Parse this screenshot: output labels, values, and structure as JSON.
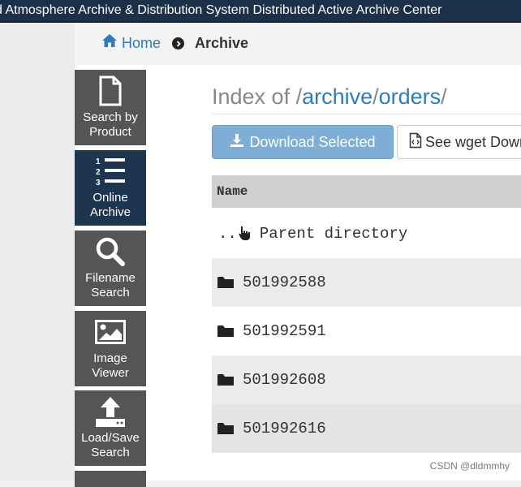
{
  "banner": {
    "title": "d Atmosphere Archive & Distribution System Distributed Active Archive Center"
  },
  "breadcrumb": {
    "home_label": "Home",
    "current_label": "Archive"
  },
  "side_nav": {
    "items": [
      {
        "line1": "Search by",
        "line2": "Product",
        "icon": "file-icon",
        "active": false
      },
      {
        "line1": "Online",
        "line2": "Archive",
        "icon": "numbered-list-icon",
        "active": true
      },
      {
        "line1": "Filename",
        "line2": "Search",
        "icon": "magnifier-icon",
        "active": false
      },
      {
        "line1": "Image",
        "line2": "Viewer",
        "icon": "image-icon",
        "active": false
      },
      {
        "line1": "Load/Save",
        "line2": "Search",
        "icon": "upload-icon",
        "active": false
      }
    ]
  },
  "index": {
    "prefix": "Index of /",
    "path_1": "archive",
    "sep": "/",
    "path_2": "orders",
    "suffix": "/"
  },
  "buttons": {
    "download_label": "Download Selected",
    "wget_label": "See wget Down"
  },
  "table": {
    "header_name": "Name",
    "parent_dots": "..",
    "parent_label": "Parent directory",
    "rows": [
      "501992588",
      "501992591",
      "501992608",
      "501992616"
    ]
  },
  "watermark": "CSDN @dldmmhy",
  "colors": {
    "banner": "#1c3148",
    "link": "#2d7dbf",
    "nav_default": "#555555",
    "nav_active": "#1e3550",
    "download_button": "#7eadd6"
  }
}
